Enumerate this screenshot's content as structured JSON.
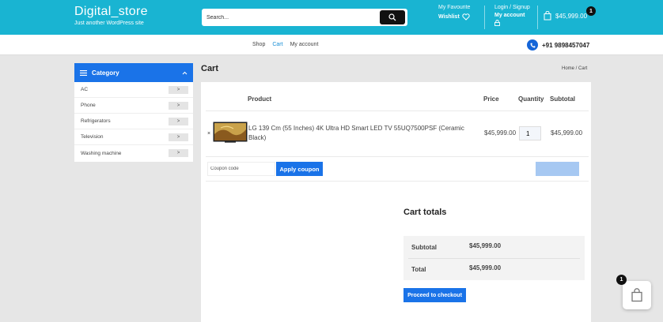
{
  "header": {
    "site_title": "Digital_store",
    "site_tagline": "Just another WordPress site",
    "search_placeholder": "Search...",
    "favourite_label": "My Favourite",
    "wishlist_label": "Wishlist",
    "login_label": "Login / Signup",
    "account_label": "My account",
    "cart_total": "$45,999.00",
    "cart_count": "1"
  },
  "nav": {
    "links": [
      {
        "label": "Shop"
      },
      {
        "label": "Cart"
      },
      {
        "label": "My account"
      }
    ],
    "active": "Cart",
    "phone": "+91 9898457047"
  },
  "sidebar": {
    "heading": "Category",
    "items": [
      {
        "label": "AC"
      },
      {
        "label": "Phone"
      },
      {
        "label": "Refrigerators"
      },
      {
        "label": "Television"
      },
      {
        "label": "Washing machine"
      }
    ],
    "arrow": ">"
  },
  "page": {
    "title": "Cart",
    "breadcrumb": "Home /  Cart"
  },
  "cart_table": {
    "headers": {
      "product": "Product",
      "price": "Price",
      "quantity": "Quantity",
      "subtotal": "Subtotal"
    },
    "item": {
      "remove": "×",
      "name": "LG 139 Cm (55 Inches) 4K Ultra HD Smart LED TV 55UQ7500PSF (Ceramic Black)",
      "price": "$45,999.00",
      "quantity": "1",
      "subtotal": "$45,999.00"
    },
    "coupon_placeholder": "Coupon code",
    "apply_label": "Apply coupon"
  },
  "totals": {
    "title": "Cart totals",
    "subtotal_label": "Subtotal",
    "subtotal_value": "$45,999.00",
    "total_label": "Total",
    "total_value": "$45,999.00",
    "checkout_label": "Proceed to checkout"
  },
  "floating_cart": {
    "count": "1"
  },
  "colors": {
    "header_bg": "#19b4d2",
    "accent_blue": "#1a73e8",
    "background": "#e6e6e6"
  }
}
